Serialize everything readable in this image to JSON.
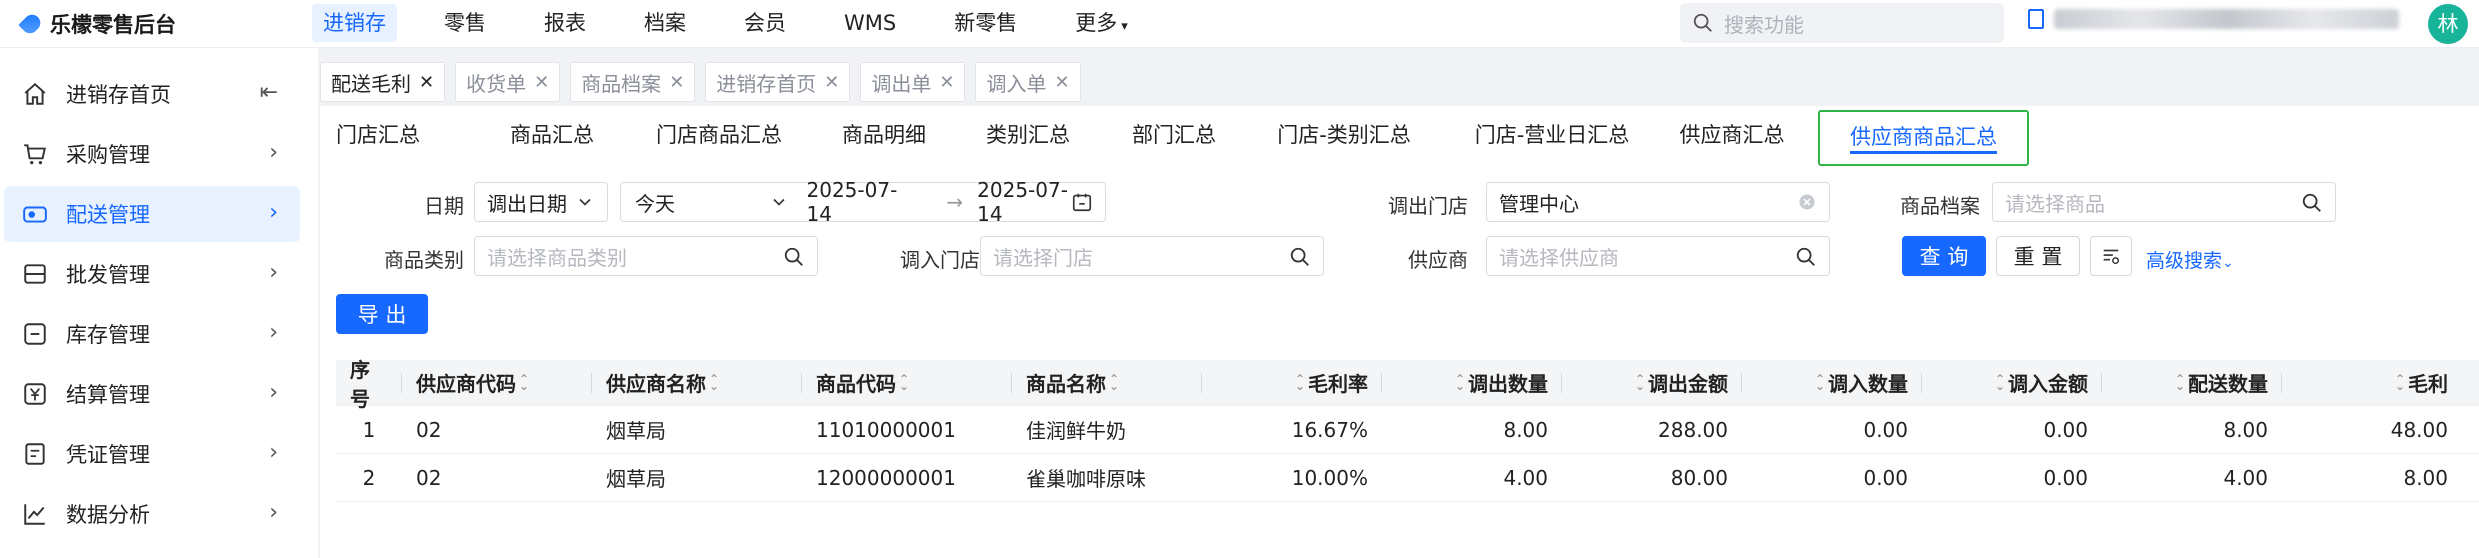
{
  "app": {
    "title": "乐檬零售后台"
  },
  "topnav": {
    "items": [
      "进销存",
      "零售",
      "报表",
      "档案",
      "会员",
      "WMS",
      "新零售",
      "更多"
    ],
    "active_index": 0,
    "search_placeholder": "搜索功能",
    "avatar": "林"
  },
  "sidebar": {
    "items": [
      {
        "label": "进销存首页",
        "icon": "home-icon"
      },
      {
        "label": "采购管理",
        "icon": "cart-icon"
      },
      {
        "label": "配送管理",
        "icon": "truck-icon"
      },
      {
        "label": "批发管理",
        "icon": "box-icon"
      },
      {
        "label": "库存管理",
        "icon": "inventory-icon"
      },
      {
        "label": "结算管理",
        "icon": "yen-icon"
      },
      {
        "label": "凭证管理",
        "icon": "voucher-icon"
      },
      {
        "label": "数据分析",
        "icon": "chart-icon"
      }
    ],
    "active_index": 2
  },
  "tabs": [
    {
      "label": "配送毛利",
      "active": true
    },
    {
      "label": "收货单",
      "active": false
    },
    {
      "label": "商品档案",
      "active": false
    },
    {
      "label": "进销存首页",
      "active": false
    },
    {
      "label": "调出单",
      "active": false
    },
    {
      "label": "调入单",
      "active": false
    }
  ],
  "subtabs": {
    "items": [
      "门店汇总",
      "商品汇总",
      "门店商品汇总",
      "商品明细",
      "类别汇总",
      "部门汇总",
      "门店-类别汇总",
      "门店-营业日汇总",
      "供应商汇总",
      "供应商商品汇总"
    ],
    "active_index": 9
  },
  "filters": {
    "date_label": "日期",
    "date_type": "调出日期",
    "date_range_type": "今天",
    "date_start": "2025-07-14",
    "date_end": "2025-07-14",
    "date_sep": "→",
    "out_store_label": "调出门店",
    "out_store_value": "管理中心",
    "product_label": "商品档案",
    "product_placeholder": "请选择商品",
    "category_label": "商品类别",
    "category_placeholder": "请选择商品类别",
    "in_store_label": "调入门店",
    "in_store_placeholder": "请选择门店",
    "supplier_label": "供应商",
    "supplier_placeholder": "请选择供应商",
    "query_btn": "查 询",
    "reset_btn": "重 置",
    "advanced": "高级搜索",
    "export_btn": "导 出"
  },
  "table": {
    "columns": [
      "序号",
      "供应商代码",
      "供应商名称",
      "商品代码",
      "商品名称",
      "毛利率",
      "调出数量",
      "调出金额",
      "调入数量",
      "调入金额",
      "配送数量",
      "毛利"
    ],
    "rows": [
      [
        "1",
        "02",
        "烟草局",
        "11010000001",
        "佳润鲜牛奶",
        "16.67%",
        "8.00",
        "288.00",
        "0.00",
        "0.00",
        "8.00",
        "48.00"
      ],
      [
        "2",
        "02",
        "烟草局",
        "12000000001",
        "雀巢咖啡原味",
        "10.00%",
        "4.00",
        "80.00",
        "0.00",
        "0.00",
        "4.00",
        "8.00"
      ]
    ]
  },
  "colors": {
    "primary": "#1668ff",
    "active_bg": "#e8f1ff",
    "highlight_border": "#2fb44a"
  }
}
